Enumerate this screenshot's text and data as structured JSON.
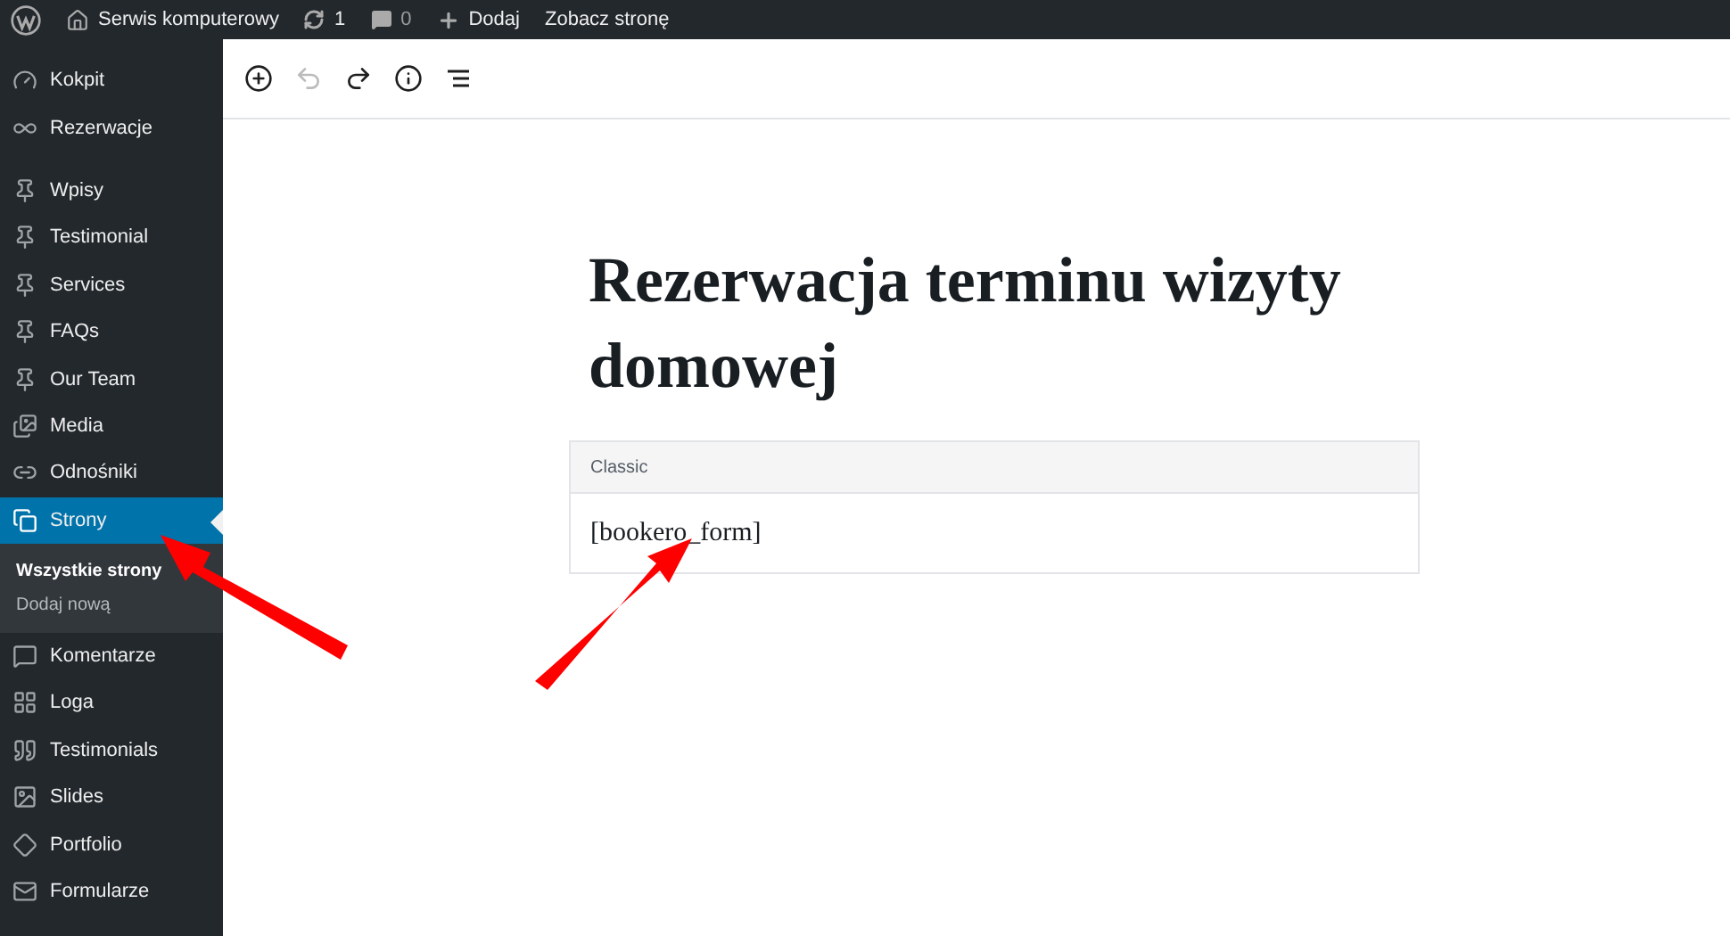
{
  "admin_bar": {
    "site_name": "Serwis komputerowy",
    "updates": "1",
    "comments": "0",
    "new_label": "Dodaj",
    "view_label": "Zobacz stronę"
  },
  "sidebar": {
    "groups": [
      [
        {
          "label": "Kokpit",
          "selected": false
        },
        {
          "label": "Rezerwacje",
          "selected": false
        }
      ],
      [
        {
          "label": "Wpisy",
          "selected": false
        },
        {
          "label": "Testimonial",
          "selected": false
        },
        {
          "label": "Services",
          "selected": false
        },
        {
          "label": "FAQs",
          "selected": false
        },
        {
          "label": "Our Team",
          "selected": false
        },
        {
          "label": "Media",
          "selected": false
        },
        {
          "label": "Odnośniki",
          "selected": false
        },
        {
          "label": "Strony",
          "selected": true,
          "children": [
            {
              "label": "Wszystkie strony",
              "selected": true
            },
            {
              "label": "Dodaj nową",
              "selected": false
            }
          ]
        },
        {
          "label": "Komentarze",
          "selected": false
        },
        {
          "label": "Loga",
          "selected": false
        },
        {
          "label": "Testimonials",
          "selected": false
        },
        {
          "label": "Slides",
          "selected": false
        },
        {
          "label": "Portfolio",
          "selected": false
        },
        {
          "label": "Formularze",
          "selected": false
        }
      ]
    ]
  },
  "toolbar": [
    {
      "disabled": false
    },
    {
      "disabled": true
    },
    {
      "disabled": false
    },
    {
      "disabled": false
    },
    {
      "disabled": false
    }
  ],
  "editor": {
    "title": "Rezerwacja terminu wizyty domowej",
    "block": {
      "label": "Classic",
      "content": "[bookero_form]"
    }
  }
}
